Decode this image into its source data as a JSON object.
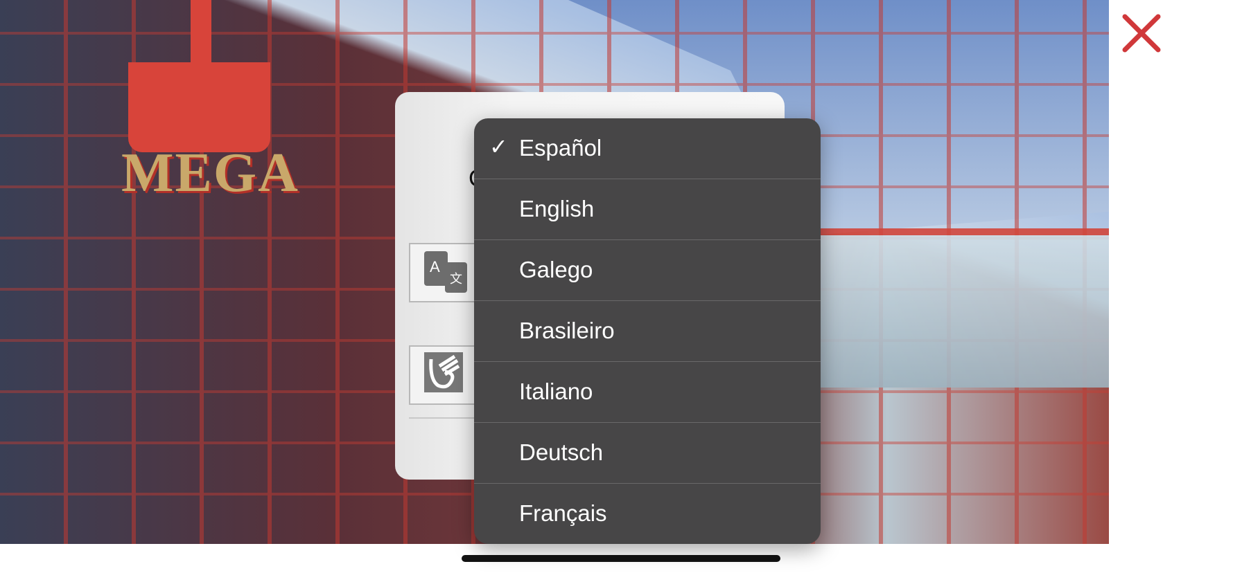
{
  "close_button": {
    "icon": "close-icon",
    "color": "#d0383a"
  },
  "dialog": {
    "title_partial": "C",
    "options": [
      {
        "icon": "translate-icon"
      },
      {
        "icon": "sign-language-icon"
      }
    ]
  },
  "language_menu": {
    "selected": "Español",
    "items": [
      {
        "label": "Español",
        "checked": true,
        "check": "✓"
      },
      {
        "label": "English",
        "checked": false
      },
      {
        "label": "Galego",
        "checked": false
      },
      {
        "label": "Brasileiro",
        "checked": false
      },
      {
        "label": "Italiano",
        "checked": false
      },
      {
        "label": "Deutsch",
        "checked": false
      },
      {
        "label": "Français",
        "checked": false
      }
    ]
  },
  "background": {
    "logo_text": "MEGA"
  }
}
